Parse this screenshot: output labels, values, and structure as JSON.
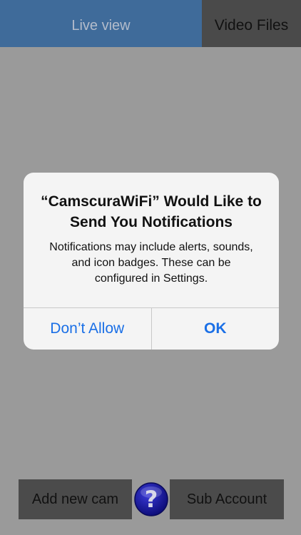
{
  "top_tabs": {
    "live_view": "Live view",
    "video_files": "Video Files"
  },
  "alert": {
    "title": "“CamscuraWiFi” Would Like to Send You Notifications",
    "message": "Notifications may include alerts, sounds, and icon badges. These can be configured in Settings.",
    "deny_label": "Don’t Allow",
    "ok_label": "OK"
  },
  "bottom_bar": {
    "add_cam_label": "Add new cam",
    "help_icon": "question-mark-icon",
    "sub_account_label": "Sub Account"
  },
  "colors": {
    "accent": "#1a6fe6",
    "live_tab": "#3f6b9a",
    "dim_background": "#9a9a9a"
  }
}
